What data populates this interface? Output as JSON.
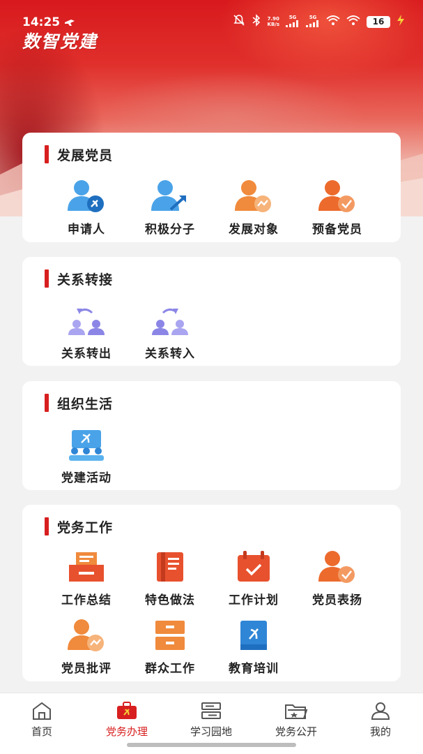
{
  "status_bar": {
    "time": "14:25",
    "net_speed_value": "7.90",
    "net_speed_unit": "KB/s",
    "sig1": "5G",
    "sig2": "5G",
    "battery": "16"
  },
  "app": {
    "title": "数智党建"
  },
  "sections": {
    "develop": {
      "title": "发展党员",
      "items": [
        {
          "label": "申请人",
          "icon": "applicant-icon"
        },
        {
          "label": "积极分子",
          "icon": "activist-icon"
        },
        {
          "label": "发展对象",
          "icon": "development-target-icon"
        },
        {
          "label": "预备党员",
          "icon": "probationary-member-icon"
        }
      ]
    },
    "transfer": {
      "title": "关系转接",
      "items": [
        {
          "label": "关系转出",
          "icon": "transfer-out-icon"
        },
        {
          "label": "关系转入",
          "icon": "transfer-in-icon"
        }
      ]
    },
    "org_life": {
      "title": "组织生活",
      "items": [
        {
          "label": "党建活动",
          "icon": "party-activity-icon"
        }
      ]
    },
    "work": {
      "title": "党务工作",
      "items": [
        {
          "label": "工作总结",
          "icon": "work-summary-icon"
        },
        {
          "label": "特色做法",
          "icon": "featured-practice-icon"
        },
        {
          "label": "工作计划",
          "icon": "work-plan-icon"
        },
        {
          "label": "党员表扬",
          "icon": "member-praise-icon"
        },
        {
          "label": "党员批评",
          "icon": "member-criticism-icon"
        },
        {
          "label": "群众工作",
          "icon": "mass-work-icon"
        },
        {
          "label": "教育培训",
          "icon": "education-training-icon"
        }
      ]
    }
  },
  "bottom_nav": {
    "items": [
      {
        "label": "首页",
        "icon": "home-icon"
      },
      {
        "label": "党务办理",
        "icon": "briefcase-icon",
        "active": true
      },
      {
        "label": "学习园地",
        "icon": "study-icon"
      },
      {
        "label": "党务公开",
        "icon": "folder-icon"
      },
      {
        "label": "我的",
        "icon": "user-icon"
      }
    ]
  },
  "colors": {
    "brand_red": "#d81f1f",
    "icon_blue": "#4aa3e8",
    "icon_orange": "#f08a3c",
    "icon_purple": "#8b86e6"
  }
}
